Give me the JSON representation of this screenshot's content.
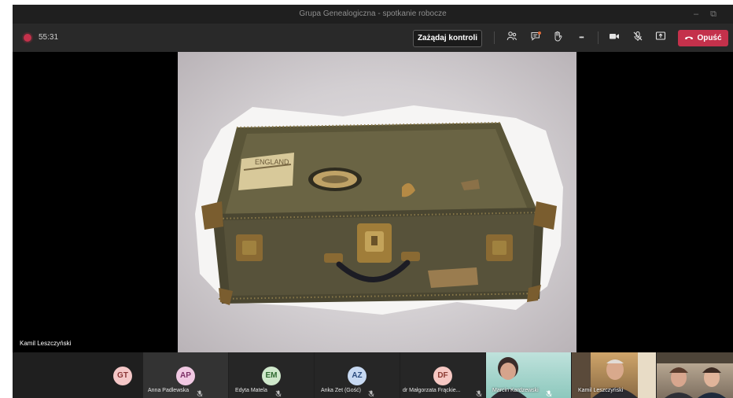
{
  "window": {
    "title": "Grupa Genealogiczna - spotkanie robocze",
    "minimize_glyph": "–",
    "restore_glyph": "⧉"
  },
  "toolbar": {
    "timer": "55:31",
    "request_control": "Zażądaj kontroli",
    "more_glyph": "•••",
    "leave": "Opuść"
  },
  "stage": {
    "presenter_name": "Kamil Leszczyński",
    "sticker_text": "ENGLAND"
  },
  "participants": [
    {
      "initials": "GT",
      "name": "",
      "avatar_bg": "#f4c7c7",
      "avatar_fg": "#8a3535"
    },
    {
      "initials": "AP",
      "name": "Anna Padlewska",
      "avatar_bg": "#f1c9e3",
      "avatar_fg": "#7c2f66"
    },
    {
      "initials": "EM",
      "name": "Edyta Matela",
      "avatar_bg": "#cfe8cb",
      "avatar_fg": "#2f6a31"
    },
    {
      "initials": "AZ",
      "name": "Anka Zet (Gość)",
      "avatar_bg": "#c7d9f2",
      "avatar_fg": "#2b4c7e"
    },
    {
      "initials": "DF",
      "name": "dr Małgorzata Frąckie...",
      "avatar_bg": "#f6c8c3",
      "avatar_fg": "#8b3a31"
    }
  ],
  "video_tiles": [
    {
      "name": "Marcin Kardzewski"
    },
    {
      "name": "Kamil Leszczyński"
    },
    {
      "name": ""
    }
  ],
  "colors": {
    "leave": "#c4314b",
    "recording": "#c4314b",
    "toolbar_bg": "#292929",
    "titlebar_bg": "#1f1f1f"
  },
  "icons": [
    "participants-icon",
    "chat-icon",
    "raise-hand-icon",
    "more-options-icon",
    "camera-icon",
    "mic-off-icon",
    "share-screen-icon",
    "phone-hangup-icon"
  ]
}
